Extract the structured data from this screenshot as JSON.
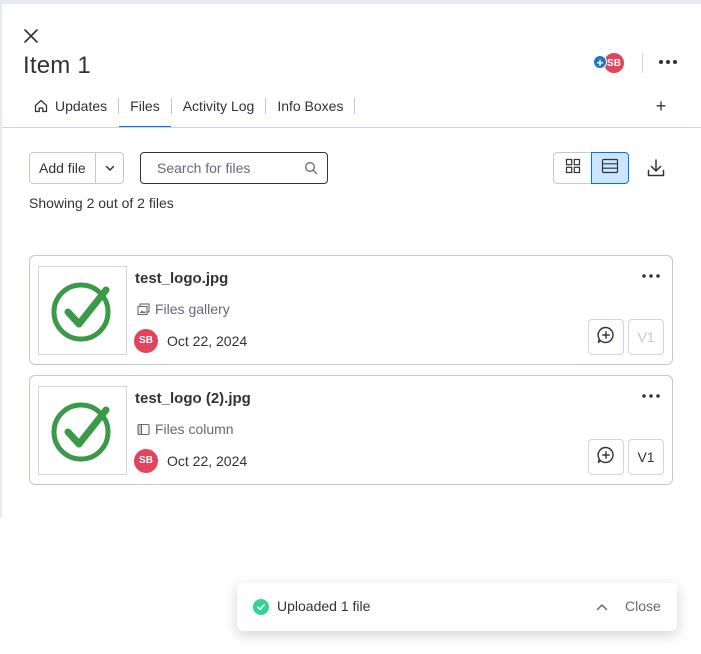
{
  "header": {
    "title": "Item 1",
    "avatar_initials": "SB",
    "avatar_color": "#e2445c",
    "add_subscriber_symbol": "+"
  },
  "tabs": [
    {
      "label": "Updates",
      "icon": "home-icon",
      "active": false
    },
    {
      "label": "Files",
      "active": true
    },
    {
      "label": "Activity Log",
      "active": false
    },
    {
      "label": "Info Boxes",
      "active": false
    }
  ],
  "tabs_add": "+",
  "toolbar": {
    "add_file_label": "Add file",
    "search_placeholder": "Search for files",
    "view_mode": "list"
  },
  "files_count_text": "Showing 2 out of 2 files",
  "files": [
    {
      "name": "test_logo.jpg",
      "source": "Files gallery",
      "source_icon": "gallery-icon",
      "owner_initials": "SB",
      "date": "Oct 22, 2024",
      "version": "V1",
      "version_enabled": false
    },
    {
      "name": "test_logo (2).jpg",
      "source": "Files column",
      "source_icon": "column-icon",
      "owner_initials": "SB",
      "date": "Oct 22, 2024",
      "version": "V1",
      "version_enabled": true
    }
  ],
  "toast": {
    "message": "Uploaded 1 file",
    "close_label": "Close",
    "status_color": "#33d391"
  },
  "colors": {
    "accent": "#0073ea",
    "check_green": "#3a9a48"
  }
}
